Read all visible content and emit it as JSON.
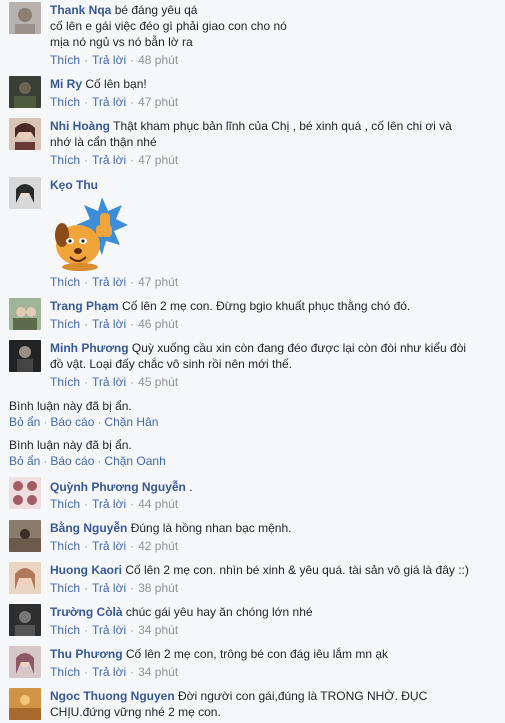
{
  "actions": {
    "like": "Thích",
    "reply": "Trả lời"
  },
  "comments": [
    {
      "name": "Thank Nqa",
      "text": "bé đáng yêu qá",
      "text2": "cố lên e gái việc đéo gì phải giao con cho nó",
      "text3": "mịa nó ngủ vs nó bẫn lờ ra",
      "time": "48 phút",
      "avatar_color": "#b7b2ad"
    },
    {
      "name": "Mi Ry",
      "text": "Cố lên bạn!",
      "time": "47 phút",
      "avatar_color": "#3a3f35"
    },
    {
      "name": "Nhi Hoàng",
      "text": "Thật kham phục bản lĩnh của Chị , bé xinh quá , cố lên chi ơi và",
      "text2": "nhớ là cẩn thận nhé",
      "time": "47 phút",
      "avatar_color": "#6b3a34"
    },
    {
      "name": "Kẹo Thu",
      "time": "47 phút",
      "avatar_color": "#2a2b2b"
    },
    {
      "name": "Trang Phạm",
      "text": "Cố lên 2 mẹ con. Đừng bgio khuất phục thằng chó đó.",
      "time": "46 phút",
      "avatar_color": "#5c6b4a"
    },
    {
      "name": "Minh Phương",
      "text": "Quỳ xuống cầu xin còn đang đéo được lại còn đòi như kiểu đòi",
      "text2": "đồ vật. Loại đấy chắc vô sinh rồi nên mới thế.",
      "time": "45 phút",
      "avatar_color": "#232323"
    },
    {
      "name": "Quỳnh Phương Nguyễn",
      "text": ".",
      "time": "44 phút",
      "avatar_color": "#a35c63"
    },
    {
      "name": "Bằng Nguyễn",
      "text": "Đúng là hồng nhan bạc mệnh.",
      "time": "42 phút",
      "avatar_color": "#6e5a4c"
    },
    {
      "name": "Huong Kaori",
      "text": "Cố lên 2 mẹ con. nhìn bé xinh & yêu quá. tài sản vô giá là đây ::)",
      "time": "38 phút",
      "avatar_color": "#b07a5a"
    },
    {
      "name": "Trường Còlà",
      "text": "chúc gái yêu hay ăn chóng lớn nhé",
      "time": "34 phút",
      "avatar_color": "#2e2e2e"
    },
    {
      "name": "Thu Phương",
      "text": "Cố lên 2 mẹ con, trông bé con đág iêu lắm mn ạk",
      "time": "34 phút",
      "avatar_color": "#8b5a66"
    },
    {
      "name": "Ngoc Thuong Nguyen",
      "text": "Đời người con gái,đúng là TRONG NHỜ. ĐỤC",
      "text2": "CHỊU.đứng vững nhé 2 mẹ con.",
      "avatar_color": "#d09446"
    }
  ],
  "hidden": [
    {
      "text": "Bình luận này đã bị ẩn.",
      "unhide": "Bỏ ẩn",
      "report": "Báo cáo",
      "block": "Chặn Hân"
    },
    {
      "text": "Bình luận này đã bị ẩn.",
      "unhide": "Bỏ ẩn",
      "report": "Báo cáo",
      "block": "Chặn Oanh"
    }
  ]
}
